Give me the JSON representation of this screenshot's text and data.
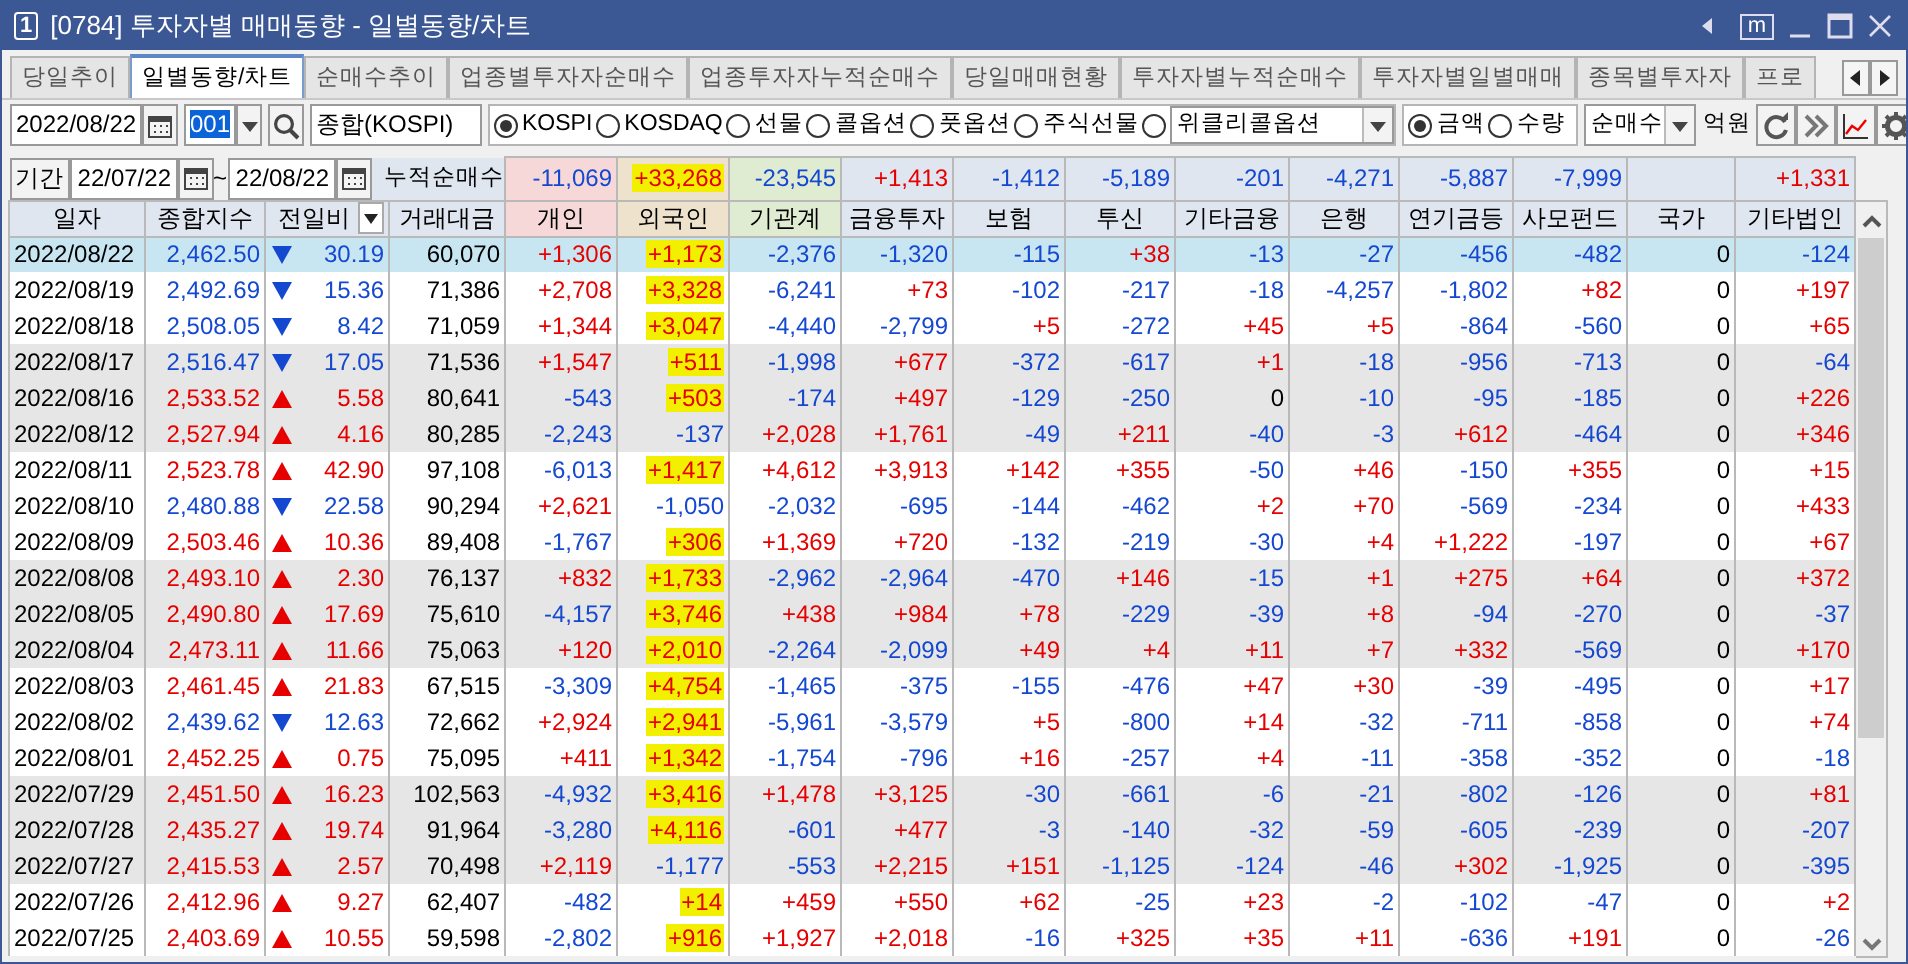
{
  "window": {
    "number": "1",
    "title": "[0784] 투자자별 매매동향 - 일별동향/차트",
    "pin_label": "m"
  },
  "tabs": [
    {
      "label": "당일추이",
      "selected": false
    },
    {
      "label": "일별동향/차트",
      "selected": true
    },
    {
      "label": "순매수추이",
      "selected": false
    },
    {
      "label": "업종별투자자순매수",
      "selected": false
    },
    {
      "label": "업종투자자누적순매수",
      "selected": false
    },
    {
      "label": "당일매매현황",
      "selected": false
    },
    {
      "label": "투자자별누적순매수",
      "selected": false
    },
    {
      "label": "투자자별일별매매",
      "selected": false
    },
    {
      "label": "종목별투자자",
      "selected": false
    },
    {
      "label": "프로",
      "selected": false
    }
  ],
  "toolbar": {
    "date": "2022/08/22",
    "code": "001",
    "market_name": "종합(KOSPI)",
    "market_options": [
      {
        "kind": "plain",
        "label": "KOSPI",
        "selected": true
      },
      {
        "kind": "plain",
        "label": "KOSDAQ",
        "selected": false
      },
      {
        "kind": "plain",
        "label": "선물",
        "selected": false
      },
      {
        "kind": "plain",
        "label": "콜옵션",
        "selected": false
      },
      {
        "kind": "plain",
        "label": "풋옵션",
        "selected": false
      },
      {
        "kind": "plain",
        "label": "주식선물",
        "selected": false
      },
      {
        "kind": "combo",
        "label": "위클리콜옵션",
        "selected": false
      }
    ],
    "unit_options": [
      {
        "label": "금액",
        "selected": true
      },
      {
        "label": "수량",
        "selected": false
      }
    ],
    "view_select": "순매수",
    "unit_label": "억원"
  },
  "period": {
    "button": "기간",
    "start": "22/07/22",
    "separator": "~",
    "end": "22/08/22",
    "total_label": "누적순매수",
    "totals": [
      {
        "value": "-11,069",
        "marked": false
      },
      {
        "value": "+33,268",
        "marked": true
      },
      {
        "value": "-23,545",
        "marked": false
      },
      {
        "value": "+1,413",
        "marked": false
      },
      {
        "value": "-1,412",
        "marked": false
      },
      {
        "value": "-5,189",
        "marked": false
      },
      {
        "value": "-201",
        "marked": false
      },
      {
        "value": "-4,271",
        "marked": false
      },
      {
        "value": "-5,887",
        "marked": false
      },
      {
        "value": "-7,999",
        "marked": false
      },
      {
        "marked": false
      },
      {
        "value": "+1,331",
        "marked": false
      }
    ]
  },
  "columns": [
    "일자",
    "종합지수",
    "전일비",
    "거래대금",
    "개인",
    "외국인",
    "기관계",
    "금융투자",
    "보험",
    "투신",
    "기타금융",
    "은행",
    "연기금등",
    "사모펀드",
    "국가",
    "기타법인"
  ],
  "rows": [
    {
      "date": "2022/08/22",
      "index": "2,462.50",
      "up": false,
      "change": "30.19",
      "amount": "60,070",
      "values": [
        "+1,306",
        "+1,173",
        "-2,376",
        "-1,320",
        "-115",
        "+38",
        "-13",
        "-27",
        "-456",
        "-482",
        "0",
        "-124"
      ],
      "marked": true,
      "selected": true
    },
    {
      "date": "2022/08/19",
      "index": "2,492.69",
      "up": false,
      "change": "15.36",
      "amount": "71,386",
      "values": [
        "+2,708",
        "+3,328",
        "-6,241",
        "+73",
        "-102",
        "-217",
        "-18",
        "-4,257",
        "-1,802",
        "+82",
        "0",
        "+197"
      ],
      "marked": true,
      "selected": false
    },
    {
      "date": "2022/08/18",
      "index": "2,508.05",
      "up": false,
      "change": "8.42",
      "amount": "71,059",
      "values": [
        "+1,344",
        "+3,047",
        "-4,440",
        "-2,799",
        "+5",
        "-272",
        "+45",
        "+5",
        "-864",
        "-560",
        "0",
        "+65"
      ],
      "marked": true,
      "selected": false
    },
    {
      "date": "2022/08/17",
      "index": "2,516.47",
      "up": false,
      "change": "17.05",
      "amount": "71,536",
      "values": [
        "+1,547",
        "+511",
        "-1,998",
        "+677",
        "-372",
        "-617",
        "+1",
        "-18",
        "-956",
        "-713",
        "0",
        "-64"
      ],
      "marked": true,
      "selected": false
    },
    {
      "date": "2022/08/16",
      "index": "2,533.52",
      "up": true,
      "change": "5.58",
      "amount": "80,641",
      "values": [
        "-543",
        "+503",
        "-174",
        "+497",
        "-129",
        "-250",
        "0",
        "-10",
        "-95",
        "-185",
        "0",
        "+226"
      ],
      "marked": true,
      "selected": false
    },
    {
      "date": "2022/08/12",
      "index": "2,527.94",
      "up": true,
      "change": "4.16",
      "amount": "80,285",
      "values": [
        "-2,243",
        "-137",
        "+2,028",
        "+1,761",
        "-49",
        "+211",
        "-40",
        "-3",
        "+612",
        "-464",
        "0",
        "+346"
      ],
      "marked": false,
      "selected": false
    },
    {
      "date": "2022/08/11",
      "index": "2,523.78",
      "up": true,
      "change": "42.90",
      "amount": "97,108",
      "values": [
        "-6,013",
        "+1,417",
        "+4,612",
        "+3,913",
        "+142",
        "+355",
        "-50",
        "+46",
        "-150",
        "+355",
        "0",
        "+15"
      ],
      "marked": true,
      "selected": false
    },
    {
      "date": "2022/08/10",
      "index": "2,480.88",
      "up": false,
      "change": "22.58",
      "amount": "90,294",
      "values": [
        "+2,621",
        "-1,050",
        "-2,032",
        "-695",
        "-144",
        "-462",
        "+2",
        "+70",
        "-569",
        "-234",
        "0",
        "+433"
      ],
      "marked": false,
      "selected": false
    },
    {
      "date": "2022/08/09",
      "index": "2,503.46",
      "up": true,
      "change": "10.36",
      "amount": "89,408",
      "values": [
        "-1,767",
        "+306",
        "+1,369",
        "+720",
        "-132",
        "-219",
        "-30",
        "+4",
        "+1,222",
        "-197",
        "0",
        "+67"
      ],
      "marked": true,
      "selected": false
    },
    {
      "date": "2022/08/08",
      "index": "2,493.10",
      "up": true,
      "change": "2.30",
      "amount": "76,137",
      "values": [
        "+832",
        "+1,733",
        "-2,962",
        "-2,964",
        "-470",
        "+146",
        "-15",
        "+1",
        "+275",
        "+64",
        "0",
        "+372"
      ],
      "marked": true,
      "selected": false
    },
    {
      "date": "2022/08/05",
      "index": "2,490.80",
      "up": true,
      "change": "17.69",
      "amount": "75,610",
      "values": [
        "-4,157",
        "+3,746",
        "+438",
        "+984",
        "+78",
        "-229",
        "-39",
        "+8",
        "-94",
        "-270",
        "0",
        "-37"
      ],
      "marked": true,
      "selected": false
    },
    {
      "date": "2022/08/04",
      "index": "2,473.11",
      "up": true,
      "change": "11.66",
      "amount": "75,063",
      "values": [
        "+120",
        "+2,010",
        "-2,264",
        "-2,099",
        "+49",
        "+4",
        "+11",
        "+7",
        "+332",
        "-569",
        "0",
        "+170"
      ],
      "marked": true,
      "selected": false
    },
    {
      "date": "2022/08/03",
      "index": "2,461.45",
      "up": true,
      "change": "21.83",
      "amount": "67,515",
      "values": [
        "-3,309",
        "+4,754",
        "-1,465",
        "-375",
        "-155",
        "-476",
        "+47",
        "+30",
        "-39",
        "-495",
        "0",
        "+17"
      ],
      "marked": true,
      "selected": false
    },
    {
      "date": "2022/08/02",
      "index": "2,439.62",
      "up": false,
      "change": "12.63",
      "amount": "72,662",
      "values": [
        "+2,924",
        "+2,941",
        "-5,961",
        "-3,579",
        "+5",
        "-800",
        "+14",
        "-32",
        "-711",
        "-858",
        "0",
        "+74"
      ],
      "marked": true,
      "selected": false
    },
    {
      "date": "2022/08/01",
      "index": "2,452.25",
      "up": true,
      "change": "0.75",
      "amount": "75,095",
      "values": [
        "+411",
        "+1,342",
        "-1,754",
        "-796",
        "+16",
        "-257",
        "+4",
        "-11",
        "-358",
        "-352",
        "0",
        "-18"
      ],
      "marked": true,
      "selected": false
    },
    {
      "date": "2022/07/29",
      "index": "2,451.50",
      "up": true,
      "change": "16.23",
      "amount": "102,563",
      "values": [
        "-4,932",
        "+3,416",
        "+1,478",
        "+3,125",
        "-30",
        "-661",
        "-6",
        "-21",
        "-802",
        "-126",
        "0",
        "+81"
      ],
      "marked": true,
      "selected": false
    },
    {
      "date": "2022/07/28",
      "index": "2,435.27",
      "up": true,
      "change": "19.74",
      "amount": "91,964",
      "values": [
        "-3,280",
        "+4,116",
        "-601",
        "+477",
        "-3",
        "-140",
        "-32",
        "-59",
        "-605",
        "-239",
        "0",
        "-207"
      ],
      "marked": true,
      "selected": false
    },
    {
      "date": "2022/07/27",
      "index": "2,415.53",
      "up": true,
      "change": "2.57",
      "amount": "70,498",
      "values": [
        "+2,119",
        "-1,177",
        "-553",
        "+2,215",
        "+151",
        "-1,125",
        "-124",
        "-46",
        "+302",
        "-1,925",
        "0",
        "-395"
      ],
      "marked": false,
      "selected": false
    },
    {
      "date": "2022/07/26",
      "index": "2,412.96",
      "up": true,
      "change": "9.27",
      "amount": "62,407",
      "values": [
        "-482",
        "+14",
        "+459",
        "+550",
        "+62",
        "-25",
        "+23",
        "-2",
        "-102",
        "-47",
        "0",
        "+2"
      ],
      "marked": true,
      "selected": false
    },
    {
      "date": "2022/07/25",
      "index": "2,403.69",
      "up": true,
      "change": "10.55",
      "amount": "59,598",
      "values": [
        "-2,802",
        "+916",
        "+1,927",
        "+2,018",
        "-16",
        "+325",
        "+35",
        "+11",
        "-636",
        "+191",
        "0",
        "-26"
      ],
      "marked": true,
      "selected": false
    }
  ]
}
